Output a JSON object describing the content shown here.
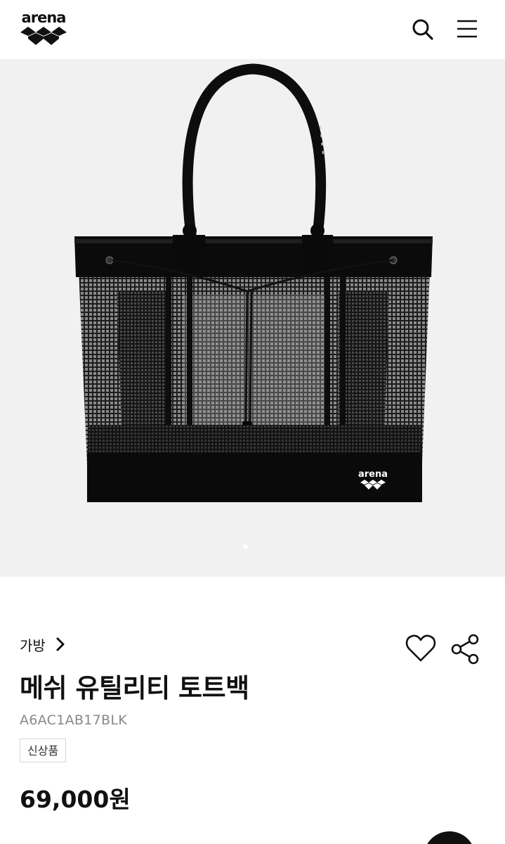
{
  "header": {
    "logo_text": "arena",
    "icons": [
      "search-icon",
      "menu-icon"
    ]
  },
  "gallery": {
    "bag_logo_text": "arena",
    "current_slide": 1
  },
  "product": {
    "breadcrumb": "가방",
    "title": "메쉬 유틸리티 토트백",
    "code": "A6AC1AB17BLK",
    "badge": "신상품",
    "price": "69,000원"
  },
  "actions": {
    "icons": [
      "heart-icon",
      "share-icon"
    ]
  },
  "colors": {
    "text": "#111111",
    "muted": "#888888",
    "image_bg": "#f1f1f1"
  }
}
